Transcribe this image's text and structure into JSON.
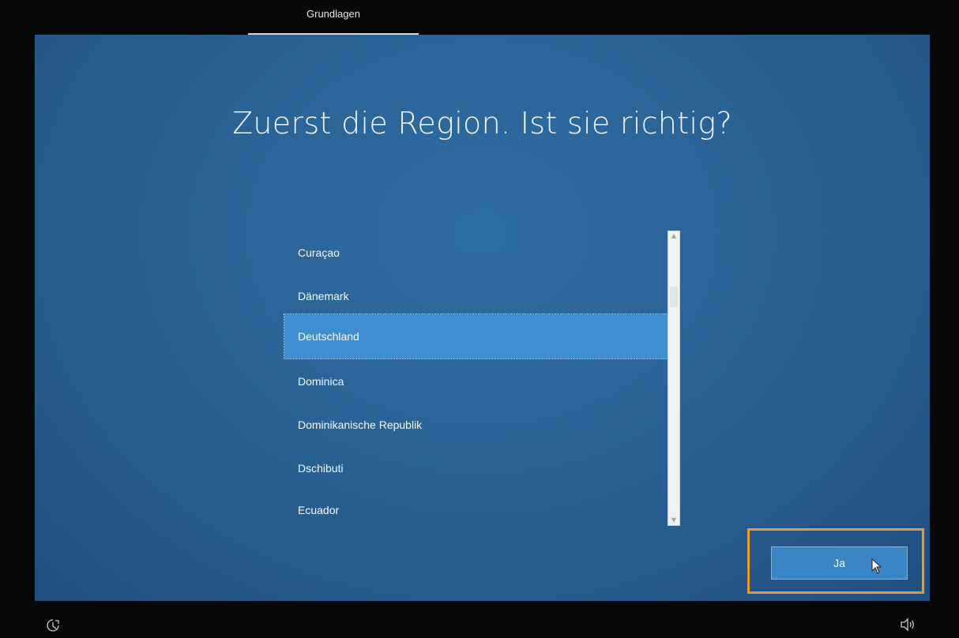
{
  "header": {
    "tab_label": "Grundlagen"
  },
  "main": {
    "title": "Zuerst die Region. Ist sie richtig?",
    "regions": [
      {
        "label": "Curaçao",
        "selected": false
      },
      {
        "label": "Dänemark",
        "selected": false
      },
      {
        "label": "Deutschland",
        "selected": true
      },
      {
        "label": "Dominica",
        "selected": false
      },
      {
        "label": "Dominikanische Republik",
        "selected": false
      },
      {
        "label": "Dschibuti",
        "selected": false
      },
      {
        "label": "Ecuador",
        "selected": false
      }
    ]
  },
  "footer": {
    "confirm_label": "Ja",
    "left_icon": "accessibility-icon",
    "right_icon": "volume-icon"
  },
  "colors": {
    "background": "#2a6395",
    "selected_item": "#3f8ed0",
    "highlight_box": "#f0962a",
    "button": "#3a85c6"
  }
}
